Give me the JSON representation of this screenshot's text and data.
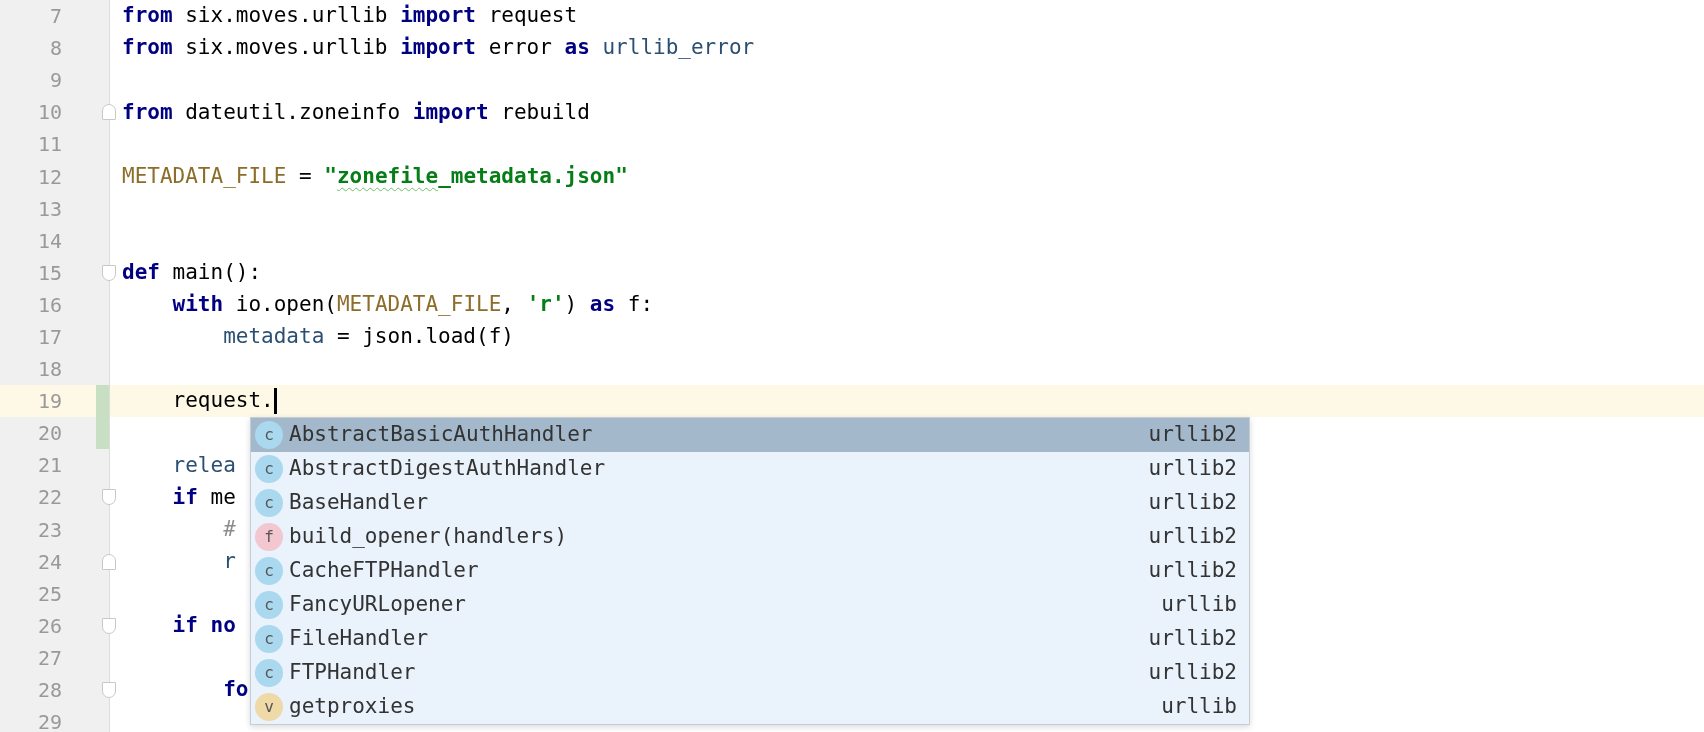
{
  "editor": {
    "lines": [
      {
        "number": "7",
        "tokens": [
          {
            "text": "from",
            "kind": "keyword"
          },
          {
            "text": " six.moves.urllib ",
            "kind": "plain"
          },
          {
            "text": "import",
            "kind": "keyword"
          },
          {
            "text": " request",
            "kind": "plain"
          }
        ]
      },
      {
        "number": "8",
        "tokens": [
          {
            "text": "from",
            "kind": "keyword"
          },
          {
            "text": " six.moves.urllib ",
            "kind": "plain"
          },
          {
            "text": "import",
            "kind": "keyword"
          },
          {
            "text": " error ",
            "kind": "plain"
          },
          {
            "text": "as",
            "kind": "keyword"
          },
          {
            "text": " urllib_error",
            "kind": "name"
          }
        ]
      },
      {
        "number": "9"
      },
      {
        "number": "10",
        "fold_end": true,
        "tokens": [
          {
            "text": "from",
            "kind": "keyword"
          },
          {
            "text": " dateutil.zoneinfo ",
            "kind": "plain"
          },
          {
            "text": "import",
            "kind": "keyword"
          },
          {
            "text": " rebuild",
            "kind": "plain"
          }
        ]
      },
      {
        "number": "11"
      },
      {
        "number": "12",
        "tokens": [
          {
            "text": "METADATA_FILE",
            "kind": "constant"
          },
          {
            "text": " = ",
            "kind": "plain"
          },
          {
            "text": "\"",
            "kind": "string"
          },
          {
            "text": "zonefile",
            "kind": "string",
            "typo": true
          },
          {
            "text": "_metadata.json\"",
            "kind": "string"
          }
        ]
      },
      {
        "number": "13"
      },
      {
        "number": "14"
      },
      {
        "number": "15",
        "fold_start": true,
        "tokens": [
          {
            "text": "def",
            "kind": "keyword"
          },
          {
            "text": " main():",
            "kind": "plain"
          }
        ]
      },
      {
        "number": "16",
        "tokens": [
          {
            "text": "    with",
            "kind": "keyword"
          },
          {
            "text": " io.open(",
            "kind": "plain"
          },
          {
            "text": "METADATA_FILE",
            "kind": "constant"
          },
          {
            "text": ", ",
            "kind": "plain"
          },
          {
            "text": "'r'",
            "kind": "string"
          },
          {
            "text": ") ",
            "kind": "plain"
          },
          {
            "text": "as",
            "kind": "keyword"
          },
          {
            "text": " f:",
            "kind": "plain"
          }
        ]
      },
      {
        "number": "17",
        "tokens": [
          {
            "text": "        metadata",
            "kind": "name"
          },
          {
            "text": " = json.load(f)",
            "kind": "plain"
          }
        ]
      },
      {
        "number": "18"
      },
      {
        "number": "19",
        "current": true,
        "changed": true,
        "caret": true,
        "tokens": [
          {
            "text": "    request.",
            "kind": "plain"
          }
        ]
      },
      {
        "number": "20",
        "changed": true
      },
      {
        "number": "21",
        "tokens": [
          {
            "text": "    relea",
            "kind": "name"
          }
        ]
      },
      {
        "number": "22",
        "fold_start": true,
        "tokens": [
          {
            "text": "    if",
            "kind": "keyword"
          },
          {
            "text": " me",
            "kind": "plain"
          }
        ]
      },
      {
        "number": "23",
        "tokens": [
          {
            "text": "        #",
            "kind": "comment"
          }
        ]
      },
      {
        "number": "24",
        "fold_end": true,
        "tokens": [
          {
            "text": "        r",
            "kind": "name"
          }
        ]
      },
      {
        "number": "25"
      },
      {
        "number": "26",
        "fold_start": true,
        "tokens": [
          {
            "text": "    if",
            "kind": "keyword"
          },
          {
            "text": " no",
            "kind": "keyword"
          }
        ]
      },
      {
        "number": "27"
      },
      {
        "number": "28",
        "fold_start": true,
        "tokens": [
          {
            "text": "        fo",
            "kind": "keyword"
          }
        ]
      },
      {
        "number": "29"
      }
    ]
  },
  "completion": {
    "items": [
      {
        "icon": "c",
        "kind": "class",
        "name": "AbstractBasicAuthHandler",
        "module": "urllib2",
        "selected": true
      },
      {
        "icon": "c",
        "kind": "class",
        "name": "AbstractDigestAuthHandler",
        "module": "urllib2",
        "selected": false
      },
      {
        "icon": "c",
        "kind": "class",
        "name": "BaseHandler",
        "module": "urllib2",
        "selected": false
      },
      {
        "icon": "f",
        "kind": "function",
        "name": "build_opener(handlers)",
        "module": "urllib2",
        "selected": false
      },
      {
        "icon": "c",
        "kind": "class",
        "name": "CacheFTPHandler",
        "module": "urllib2",
        "selected": false
      },
      {
        "icon": "c",
        "kind": "class",
        "name": "FancyURLopener",
        "module": "urllib",
        "selected": false
      },
      {
        "icon": "c",
        "kind": "class",
        "name": "FileHandler",
        "module": "urllib2",
        "selected": false
      },
      {
        "icon": "c",
        "kind": "class",
        "name": "FTPHandler",
        "module": "urllib2",
        "selected": false
      },
      {
        "icon": "v",
        "kind": "variable",
        "name": "getproxies",
        "module": "urllib",
        "selected": false
      }
    ]
  }
}
